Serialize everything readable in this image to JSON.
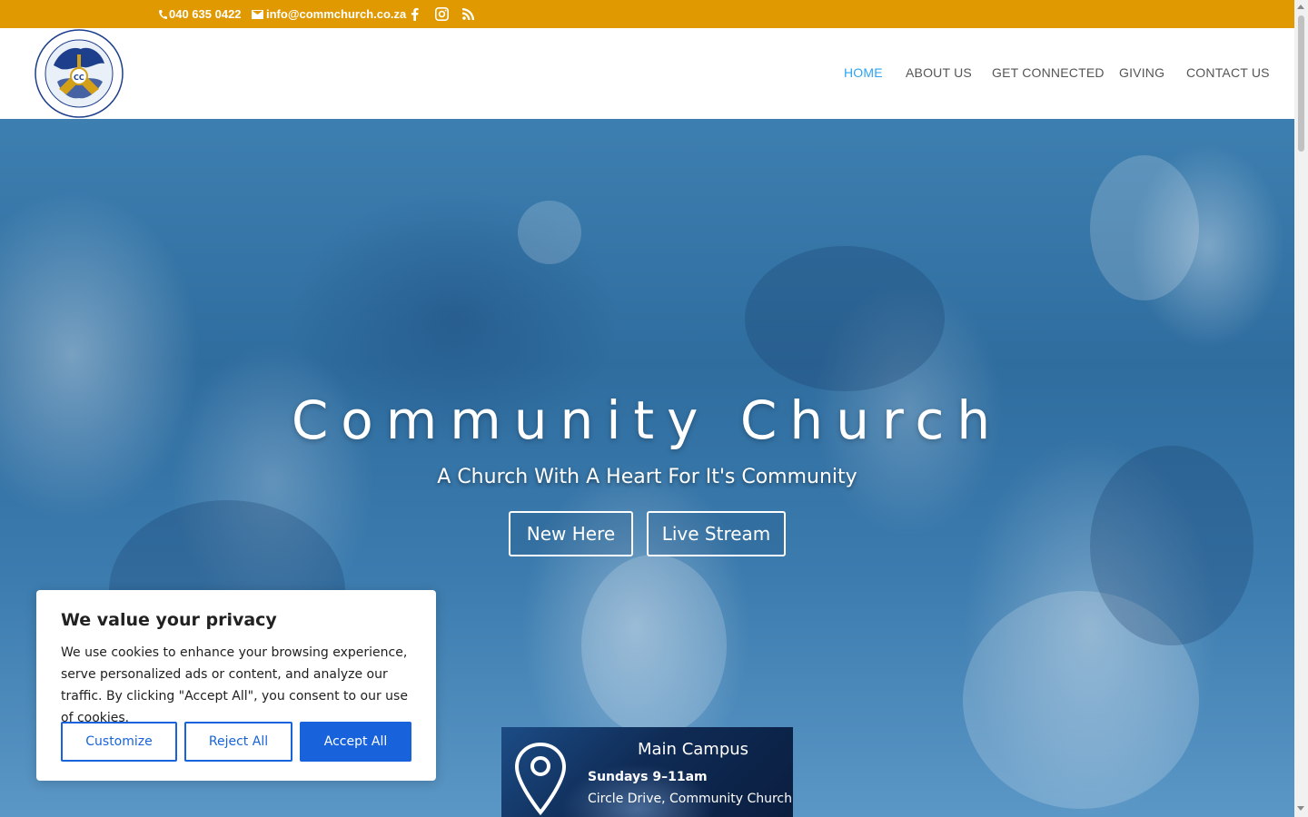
{
  "topbar": {
    "phone": "040 635 0422",
    "email": "info@commchurch.co.za",
    "background_color": "#e09900",
    "social_icons": [
      "facebook-icon",
      "instagram-icon",
      "rss-icon"
    ]
  },
  "header": {
    "logo_icon": "church-crest-logo",
    "nav": {
      "home": "HOME",
      "about": "ABOUT US",
      "connected": "GET CONNECTED",
      "giving": "GIVING",
      "contact": "CONTACT US"
    },
    "active_item": "HOME",
    "active_color": "#2ea3f2"
  },
  "hero": {
    "title": "Community Church",
    "subtitle": "A Church With A Heart For It's Community",
    "buttons": {
      "new_here": "New Here",
      "live_stream": "Live Stream"
    }
  },
  "campus": {
    "icon": "location-pin-icon",
    "title": "Main Campus",
    "time": "Sundays 9–11am",
    "address": "Circle Drive, Community Church"
  },
  "cookie_banner": {
    "title": "We value your privacy",
    "body": "We use cookies to enhance your browsing experience, serve personalized ads or content, and analyze our traffic. By clicking \"Accept All\", you consent to our use of cookies.",
    "customize": "Customize",
    "reject": "Reject All",
    "accept": "Accept All",
    "accent_color": "#1863dc"
  }
}
